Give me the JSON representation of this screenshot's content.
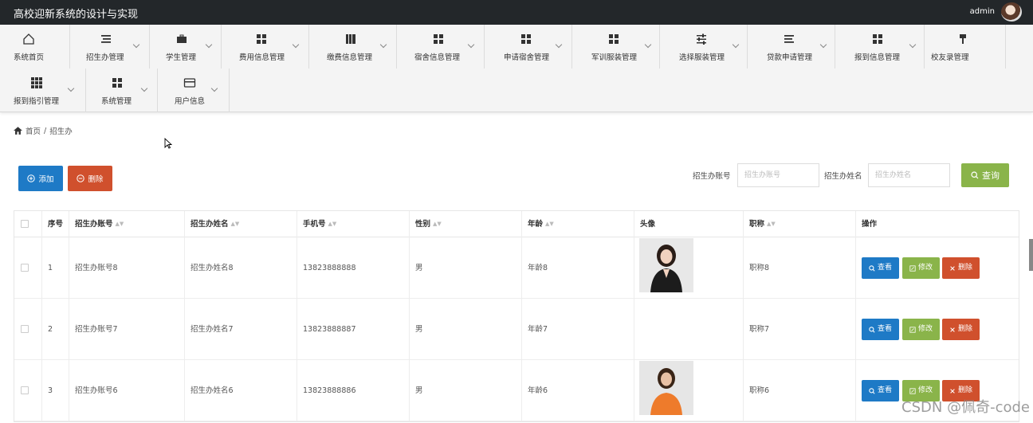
{
  "header": {
    "title": "高校迎新系统的设计与实现",
    "user": "admin"
  },
  "nav": [
    {
      "label": "系统首页",
      "icon": "home-icon"
    },
    {
      "label": "招生办管理",
      "icon": "list-icon"
    },
    {
      "label": "学生管理",
      "icon": "briefcase-icon"
    },
    {
      "label": "费用信息管理",
      "icon": "grid-icon"
    },
    {
      "label": "缴费信息管理",
      "icon": "book-icon"
    },
    {
      "label": "宿舍信息管理",
      "icon": "grid-icon"
    },
    {
      "label": "申请宿舍管理",
      "icon": "grid-icon"
    },
    {
      "label": "军训服装管理",
      "icon": "grid-icon"
    },
    {
      "label": "选择服装管理",
      "icon": "sliders-icon"
    },
    {
      "label": "贷款申请管理",
      "icon": "list-icon"
    },
    {
      "label": "报到信息管理",
      "icon": "grid-icon"
    },
    {
      "label": "校友录管理",
      "icon": "pin-icon"
    },
    {
      "label": "报到指引管理",
      "icon": "grid9-icon"
    },
    {
      "label": "系统管理",
      "icon": "grid-icon"
    },
    {
      "label": "用户信息",
      "icon": "card-icon"
    }
  ],
  "breadcrumb": {
    "home": "首页",
    "separator": "/",
    "current": "招生办"
  },
  "toolbar": {
    "add_label": "添加",
    "delete_label": "删除"
  },
  "search": {
    "account_label": "招生办账号",
    "account_placeholder": "招生办账号",
    "name_label": "招生办姓名",
    "name_placeholder": "招生办姓名",
    "query_label": "查询"
  },
  "table": {
    "columns": [
      "序号",
      "招生办账号",
      "招生办姓名",
      "手机号",
      "性别",
      "年龄",
      "头像",
      "职称",
      "操作"
    ],
    "rows": [
      {
        "index": "1",
        "account": "招生办账号8",
        "name": "招生办姓名8",
        "phone": "13823888888",
        "gender": "男",
        "age": "年龄8",
        "title": "职称8"
      },
      {
        "index": "2",
        "account": "招生办账号7",
        "name": "招生办姓名7",
        "phone": "13823888887",
        "gender": "男",
        "age": "年龄7",
        "title": "职称7"
      },
      {
        "index": "3",
        "account": "招生办账号6",
        "name": "招生办姓名6",
        "phone": "13823888886",
        "gender": "男",
        "age": "年龄6",
        "title": "职称6"
      }
    ],
    "actions": {
      "view": "查看",
      "edit": "修改",
      "delete": "删除"
    }
  },
  "watermark": "CSDN @佩奇-code",
  "colors": {
    "primary": "#1e7ac6",
    "success": "#8ab44a",
    "danger": "#d0502d",
    "header": "#23272a"
  }
}
